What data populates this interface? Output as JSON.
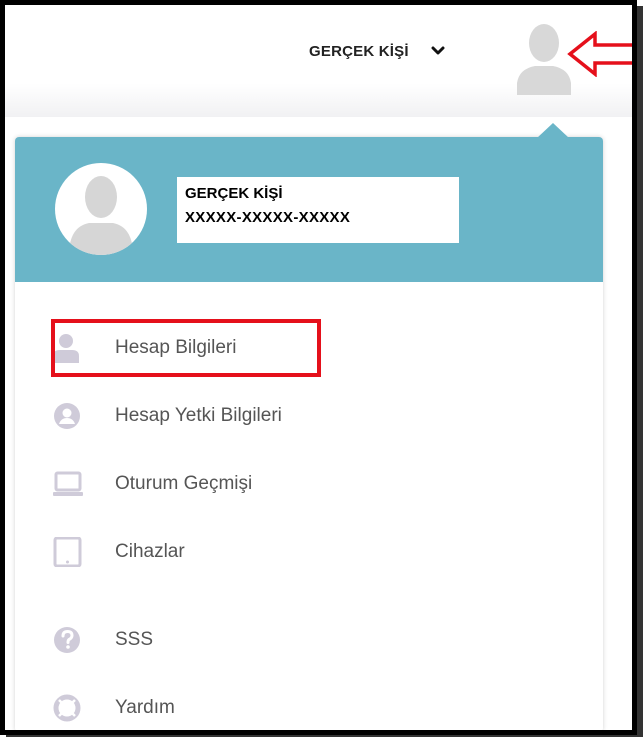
{
  "header": {
    "user_label": "GERÇEK KİŞİ",
    "chevron_icon": "chevron-down-icon",
    "avatar_icon": "user-silhouette-icon",
    "annotation_arrow_color": "#e5101b"
  },
  "profile": {
    "name": "GERÇEK KİŞİ",
    "id": "XXXXX-XXXXX-XXXXX",
    "header_color": "#6ab5c8"
  },
  "menu": {
    "items": [
      {
        "label": "Hesap Bilgileri",
        "icon": "user-icon"
      },
      {
        "label": "Hesap Yetki Bilgileri",
        "icon": "user-circle-icon"
      },
      {
        "label": "Oturum Geçmişi",
        "icon": "laptop-icon"
      },
      {
        "label": "Cihazlar",
        "icon": "tablet-icon"
      },
      {
        "label": "SSS",
        "icon": "question-circle-icon"
      },
      {
        "label": "Yardım",
        "icon": "life-ring-icon"
      }
    ],
    "highlight_color": "#e5101b",
    "icon_color": "#cfcbd9"
  }
}
